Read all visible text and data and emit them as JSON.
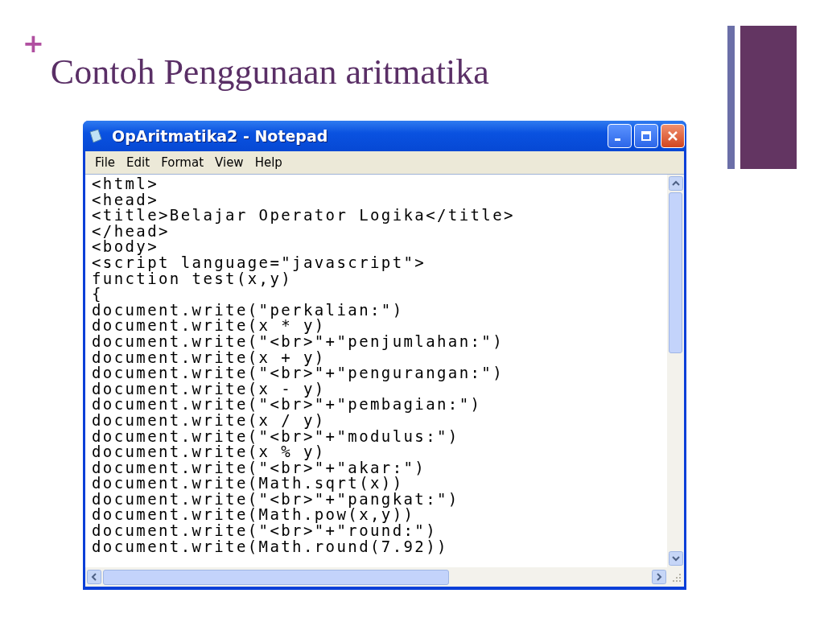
{
  "slide": {
    "bullet": "+",
    "title": "Contoh Penggunaan aritmatika"
  },
  "window": {
    "title": "OpAritmatika2 - Notepad"
  },
  "menu": [
    {
      "label": "File"
    },
    {
      "label": "Edit"
    },
    {
      "label": "Format"
    },
    {
      "label": "View"
    },
    {
      "label": "Help"
    }
  ],
  "editor": {
    "lines": [
      "<html>",
      "<head>",
      "<title>Belajar Operator Logika</title>",
      "</head>",
      "<body>",
      "<script language=\"javascript\">",
      "function test(x,y)",
      "{",
      "document.write(\"perkalian:\")",
      "document.write(x * y)",
      "document.write(\"<br>\"+\"penjumlahan:\")",
      "document.write(x + y)",
      "document.write(\"<br>\"+\"pengurangan:\")",
      "document.write(x - y)",
      "document.write(\"<br>\"+\"pembagian:\")",
      "document.write(x / y)",
      "document.write(\"<br>\"+\"modulus:\")",
      "document.write(x % y)",
      "document.write(\"<br>\"+\"akar:\")",
      "document.write(Math.sqrt(x))",
      "document.write(\"<br>\"+\"pangkat:\")",
      "document.write(Math.pow(x,y))",
      "document.write(\"<br>\"+\"round:\")",
      "document.write(Math.round(7.92))"
    ]
  }
}
